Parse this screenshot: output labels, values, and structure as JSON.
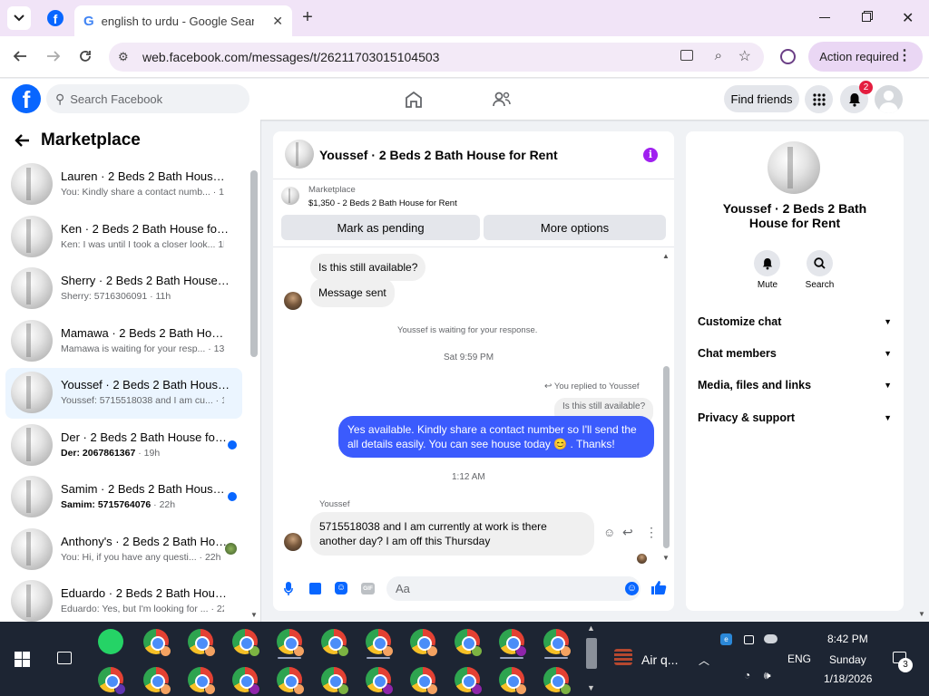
{
  "browser": {
    "tab_title": "english to urdu - Google Search",
    "url": "web.facebook.com/messages/t/26211703015104503",
    "action_required": "Action required"
  },
  "header": {
    "search_placeholder": "Search Facebook",
    "find_friends": "Find friends",
    "notification_count": "2",
    "brand_color": "#0866ff"
  },
  "sidebar": {
    "title": "Marketplace",
    "conversations": [
      {
        "title": "Lauren · 2 Beds 2 Bath House for Rent",
        "sender": "",
        "snippet": "You: Kindly share a contact numb...",
        "time": " · 1m",
        "unread": false,
        "selected": false
      },
      {
        "title": "Ken · 2 Beds 2 Bath House for Rent",
        "sender": "",
        "snippet": "Ken: I was until I took a closer look...",
        "time": " 1h",
        "unread": false,
        "selected": false
      },
      {
        "title": "Sherry · 2 Beds 2 Bath House for Rent",
        "sender": "",
        "snippet": "Sherry: 5716306091 · 11h",
        "time": "",
        "unread": false,
        "selected": false
      },
      {
        "title": "Mamawa · 2 Beds 2 Bath House for Rent",
        "sender": "",
        "snippet": "Mamawa is waiting for your resp...",
        "time": " · 13h",
        "unread": false,
        "selected": false
      },
      {
        "title": "Youssef · 2 Beds 2 Bath House for Rent",
        "sender": "",
        "snippet": "Youssef: 5715518038 and I am cu...",
        "time": " · 19h",
        "unread": false,
        "selected": true
      },
      {
        "title": "Der · 2 Beds 2 Bath House for Rent",
        "sender": "",
        "snippet": "Der: 2067861367",
        "time": " · 19h",
        "unread": true,
        "selected": false
      },
      {
        "title": "Samim · 2 Beds 2 Bath House for Rent",
        "sender": "",
        "snippet": "Samim: 5715764076",
        "time": " · 22h",
        "unread": true,
        "selected": false
      },
      {
        "title": "Anthony's · 2 Beds 2 Bath House for Rent",
        "sender": "",
        "snippet": "You: Hi, if you have any questi...",
        "time": " · 22h",
        "unread": false,
        "selected": false
      },
      {
        "title": "Eduardo · 2 Beds 2 Bath House for Rent",
        "sender": "",
        "snippet": "Eduardo: Yes, but I'm looking for ...",
        "time": " · 22h",
        "unread": false,
        "selected": false
      }
    ]
  },
  "chat": {
    "title": "Youssef · 2 Beds 2 Bath House for Rent",
    "listing_label": "Marketplace",
    "listing_detail": "$1,350 - 2 Beds 2 Bath House for Rent",
    "mark_pending": "Mark as pending",
    "more_options": "More options",
    "messages": {
      "q1": "Is this still available?",
      "sent": "Message sent",
      "waiting": "Youssef is waiting for your response.",
      "time1": "Sat 9:59 PM",
      "replied_to": "You replied to Youssef",
      "quoted": "Is this still available?",
      "reply": "Yes available. Kindly share a contact number so I'll send the all details easily. You can see house today 😊 . Thanks!",
      "time2": "1:12 AM",
      "sender": "Youssef",
      "incoming": "5715518038 and I am currently at work is there another day? I am off this Thursday"
    },
    "composer_placeholder": "Aa"
  },
  "info": {
    "name": "Youssef · 2 Beds 2 Bath House for Rent",
    "mute": "Mute",
    "search": "Search",
    "sections": [
      "Customize chat",
      "Chat members",
      "Media, files and links",
      "Privacy & support"
    ]
  },
  "taskbar": {
    "weather": "Air q...",
    "language": "ENG",
    "time": "8:42 PM",
    "day": "Sunday",
    "date": "1/18/2026",
    "notif_count": "3"
  }
}
